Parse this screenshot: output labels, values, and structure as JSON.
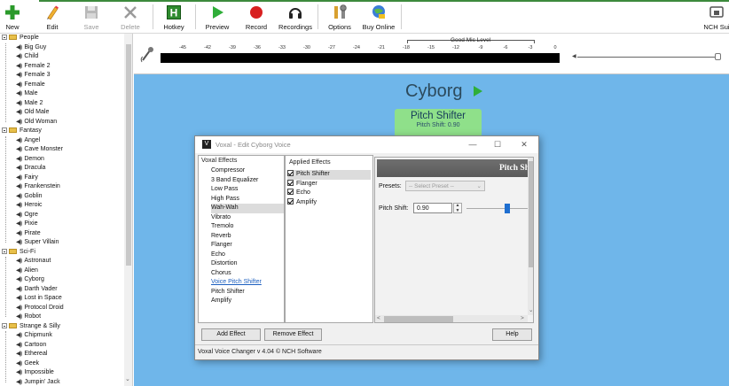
{
  "toolbar": {
    "buttons": [
      {
        "label": "New"
      },
      {
        "label": "Edit"
      },
      {
        "label": "Save"
      },
      {
        "label": "Delete"
      },
      {
        "label": "Hotkey"
      },
      {
        "label": "Preview"
      },
      {
        "label": "Record"
      },
      {
        "label": "Recordings"
      },
      {
        "label": "Options"
      },
      {
        "label": "Buy Online"
      },
      {
        "label": "NCH Sui"
      }
    ]
  },
  "tree": {
    "categories": [
      {
        "label": "People",
        "items": [
          "Big Guy",
          "Child",
          "Female 2",
          "Female 3",
          "Female",
          "Male",
          "Male 2",
          "Old Male",
          "Old Woman"
        ]
      },
      {
        "label": "Fantasy",
        "items": [
          "Angel",
          "Cave Monster",
          "Demon",
          "Dracula",
          "Fairy",
          "Frankenstein",
          "Goblin",
          "Heroic",
          "Ogre",
          "Pixie",
          "Pirate",
          "Super Villain"
        ]
      },
      {
        "label": "Sci-Fi",
        "items": [
          "Astronaut",
          "Alien",
          "Cyborg",
          "Darth Vader",
          "Lost in Space",
          "Protocol Droid",
          "Robot"
        ]
      },
      {
        "label": "Strange & Silly",
        "items": [
          "Chipmunk",
          "Cartoon",
          "Ethereal",
          "Geek",
          "Impossible",
          "Jumpin' Jack"
        ]
      }
    ]
  },
  "meter": {
    "scale": [
      "-45",
      "-42",
      "-39",
      "-36",
      "-33",
      "-30",
      "-27",
      "-24",
      "-21",
      "-18",
      "-15",
      "-12",
      "-9",
      "-6",
      "-3",
      "0"
    ],
    "good_mic_label": "Good Mic Level"
  },
  "voice": {
    "name": "Cyborg",
    "effect_name": "Pitch Shifter",
    "effect_value": "Pitch Shift: 0.90"
  },
  "dialog": {
    "title": "Voxal - Edit Cyborg Voice",
    "effects_header": "Voxal Effects",
    "effects": [
      "Compressor",
      "3 Band Equalizer",
      "Low Pass",
      "High Pass",
      "Wah-Wah",
      "Vibrato",
      "Tremolo",
      "Reverb",
      "Flanger",
      "Echo",
      "Distortion",
      "Chorus",
      "Voice Pitch Shifter",
      "Pitch Shifter",
      "Amplify"
    ],
    "selected_effect": "Wah-Wah",
    "link_effect": "Voice Pitch Shifter",
    "applied_header": "Applied Effects",
    "applied": [
      "Pitch Shifter",
      "Flanger",
      "Echo",
      "Amplify"
    ],
    "panel_title": "Pitch Sh",
    "presets_label": "Presets:",
    "presets_value": "-- Select Preset --",
    "pitch_label": "Pitch Shift:",
    "pitch_value": "0.90",
    "add_button": "Add Effect",
    "remove_button": "Remove Effect",
    "help_button": "Help",
    "status": "Voxal Voice Changer v 4.04 © NCH Software"
  }
}
